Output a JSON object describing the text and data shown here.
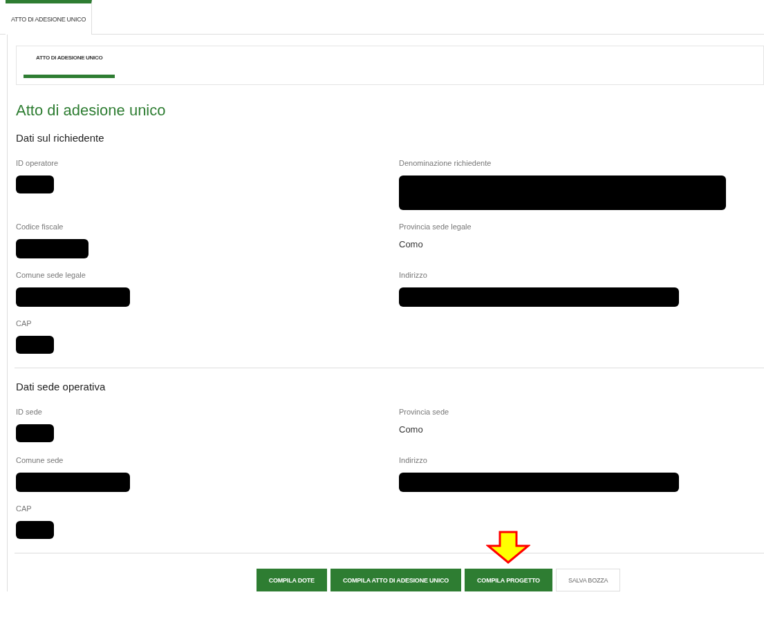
{
  "tabs": [
    {
      "label": "ATTO DI ADESIONE UNICO",
      "selected": true
    }
  ],
  "subtabs": [
    {
      "label": "ATTO DI ADESIONE UNICO",
      "selected": true
    }
  ],
  "title": "Atto di adesione unico",
  "sections": [
    {
      "title": "Dati sul richiedente",
      "fields": [
        {
          "label": "ID operatore",
          "kind": "redacted"
        },
        {
          "label": "Denominazione richiedente",
          "kind": "redacted"
        },
        {
          "label": "Codice fiscale",
          "kind": "redacted"
        },
        {
          "label": "Provincia sede legale",
          "kind": "text",
          "value": "Como"
        },
        {
          "label": "Comune sede legale",
          "kind": "redacted"
        },
        {
          "label": "Indirizzo",
          "kind": "redacted"
        },
        {
          "label": "CAP",
          "kind": "redacted"
        }
      ]
    },
    {
      "title": "Dati sede operativa",
      "fields": [
        {
          "label": "ID sede",
          "kind": "redacted"
        },
        {
          "label": "Provincia sede",
          "kind": "text",
          "value": "Como"
        },
        {
          "label": "Comune sede",
          "kind": "redacted"
        },
        {
          "label": "Indirizzo",
          "kind": "redacted"
        },
        {
          "label": "CAP",
          "kind": "redacted"
        }
      ]
    }
  ],
  "buttons": [
    {
      "label": "COMPILA DOTE",
      "kind": "primary",
      "highlighted": false
    },
    {
      "label": "COMPILA ATTO DI ADESIONE UNICO",
      "kind": "primary",
      "highlighted": false
    },
    {
      "label": "COMPILA PROGETTO",
      "kind": "primary",
      "highlighted": true
    },
    {
      "label": "SALVA BOZZA",
      "kind": "secondary",
      "highlighted": false
    }
  ]
}
